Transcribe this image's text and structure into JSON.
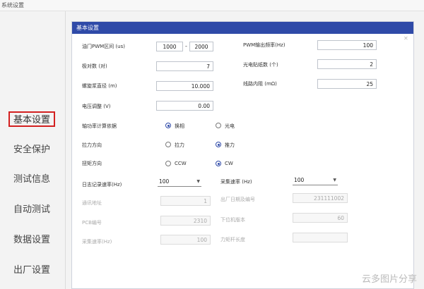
{
  "window": {
    "title": "系统设置"
  },
  "sidebar": {
    "items": [
      {
        "label": "基本设置",
        "active": true
      },
      {
        "label": "安全保护"
      },
      {
        "label": "测试信息"
      },
      {
        "label": "自动测试"
      },
      {
        "label": "数据设置"
      },
      {
        "label": "出厂设置"
      }
    ]
  },
  "panel": {
    "title": "基本设置",
    "throttle": {
      "label": "油门PWM区间 (us)",
      "min": "1000",
      "max": "2000"
    },
    "pwm_freq": {
      "label": "PWM输出频率(Hz)",
      "value": "100"
    },
    "pole_pairs": {
      "label": "极对数 (对)",
      "value": "7"
    },
    "photo_count": {
      "label": "光电贴纸数 (个)",
      "value": "2"
    },
    "prop_radius": {
      "label": "螺旋浆直径 (m)",
      "value": "10.000"
    },
    "line_res": {
      "label": "线路内阻 (mΩ)",
      "value": "25"
    },
    "voltage_adj": {
      "label": "电压调整 (V)",
      "value": "0.00"
    },
    "shaft_power": {
      "label": "轴功率计算依据",
      "opt1": "换相",
      "opt2": "光电",
      "selected": 1
    },
    "pull_dir": {
      "label": "拉力方向",
      "opt1": "拉力",
      "opt2": "推力",
      "selected": 2
    },
    "torque_dir": {
      "label": "扭矩方向",
      "opt1": "CCW",
      "opt2": "CW",
      "selected": 2
    },
    "log_rate": {
      "label": "日志记录速率(Hz)",
      "value": "100"
    },
    "sample_rate": {
      "label": "采集速率 (Hz)",
      "value": "100"
    },
    "comm_addr": {
      "label": "通讯地址",
      "value": "1"
    },
    "factory_date": {
      "label": "出厂日期及编号",
      "value": "231111002"
    },
    "pcb_no": {
      "label": "PCB编号",
      "value": "2310"
    },
    "fw_version": {
      "label": "下位机版本",
      "value": "60"
    },
    "sample_rate2": {
      "label": "采集速率(Hz)",
      "value": "100"
    },
    "arm_len": {
      "label": "力矩杆长度",
      "value": ""
    }
  },
  "watermark": "云多图片分享"
}
